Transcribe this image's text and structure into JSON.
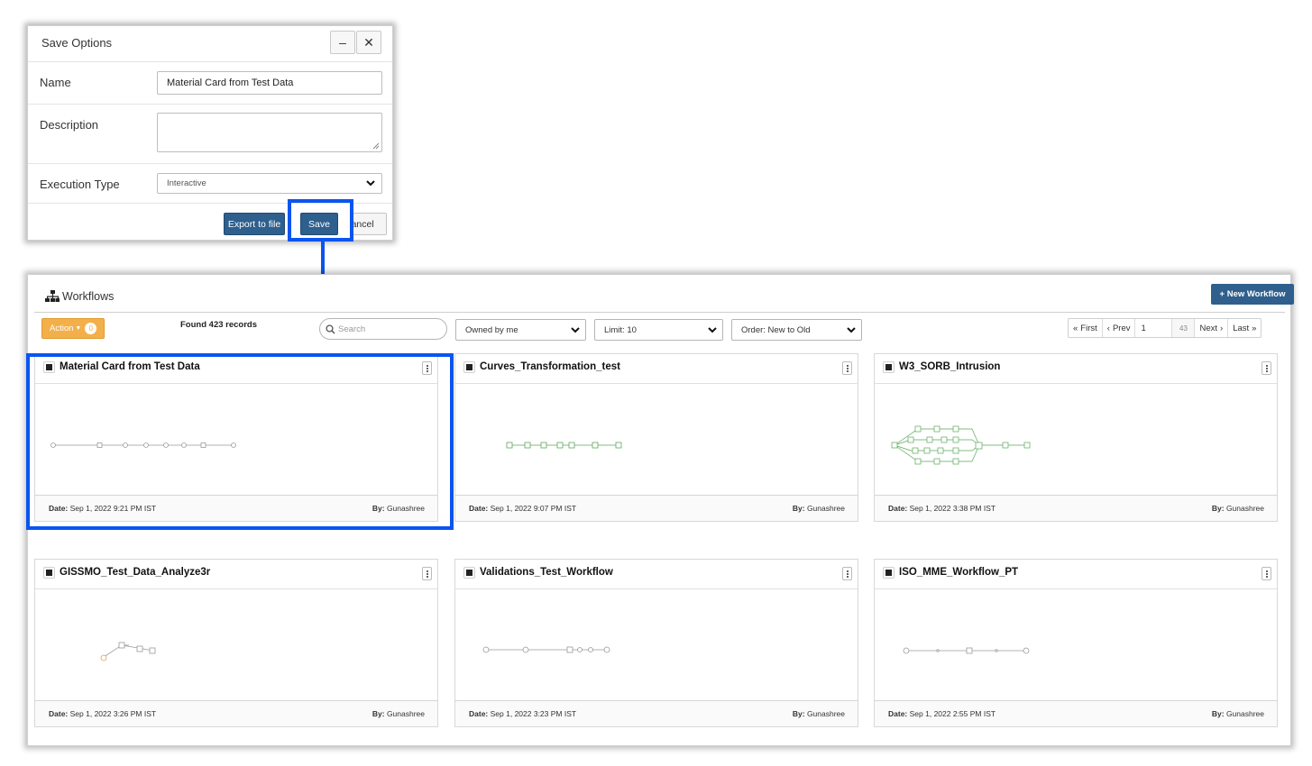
{
  "dialog": {
    "title": "Save Options",
    "minimize_icon": "minus-icon",
    "close_icon": "close-icon",
    "name_label": "Name",
    "name_value": "Material Card from Test Data",
    "description_label": "Description",
    "description_value": "",
    "execution_label": "Execution Type",
    "execution_value": "Interactive",
    "export_label": "Export to file",
    "save_label": "Save",
    "cancel_label": "Cancel"
  },
  "workflows": {
    "title": "Workflows",
    "new_button": "+ New Workflow",
    "action_label": "Action",
    "action_count": "0",
    "found": "Found 423 records",
    "search_placeholder": "Search",
    "owner_filter": "Owned by me",
    "limit_filter": "Limit: 10",
    "order_filter": "Order: New to Old",
    "pager": {
      "first": "First",
      "prev": "Prev",
      "page": "1",
      "total": "43",
      "next": "Next",
      "last": "Last"
    },
    "date_label": "Date:",
    "by_label": "By:",
    "cards": [
      {
        "title": "Material Card from Test Data",
        "date": "Sep 1, 2022 9:21 PM IST",
        "by": "Gunashree"
      },
      {
        "title": "Curves_Transformation_test",
        "date": "Sep 1, 2022 9:07 PM IST",
        "by": "Gunashree"
      },
      {
        "title": "W3_SORB_Intrusion",
        "date": "Sep 1, 2022 3:38 PM IST",
        "by": "Gunashree"
      },
      {
        "title": "GISSMO_Test_Data_Analyze3r",
        "date": "Sep 1, 2022 3:26 PM IST",
        "by": "Gunashree"
      },
      {
        "title": "Validations_Test_Workflow",
        "date": "Sep 1, 2022 3:23 PM IST",
        "by": "Gunashree"
      },
      {
        "title": "ISO_MME_Workflow_PT",
        "date": "Sep 1, 2022 2:55 PM IST",
        "by": "Gunashree"
      }
    ]
  },
  "colors": {
    "primary": "#2e5f8d",
    "action": "#f3b04a",
    "highlight": "#0a55f0",
    "graph_green": "#5aa85a",
    "graph_gray": "#9a9a9a"
  }
}
